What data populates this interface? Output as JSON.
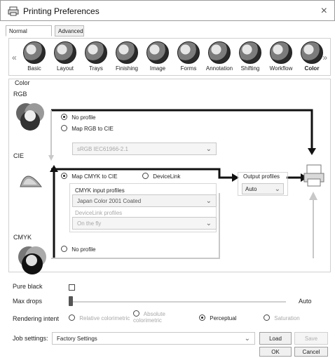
{
  "window": {
    "title": "Printing Preferences"
  },
  "tabs": [
    {
      "label": "Normal"
    },
    {
      "label": "Advanced"
    }
  ],
  "toolbar": {
    "items": [
      {
        "label": "Basic"
      },
      {
        "label": "Layout"
      },
      {
        "label": "Trays"
      },
      {
        "label": "Finishing"
      },
      {
        "label": "Image"
      },
      {
        "label": "Forms"
      },
      {
        "label": "Annotation"
      },
      {
        "label": "Shifting"
      },
      {
        "label": "Workflow"
      },
      {
        "label": "Color"
      }
    ],
    "selected": "Color"
  },
  "color_section": {
    "group_label": "Color",
    "rgb_label": "RGB",
    "cie_label": "CIE",
    "cmyk_label": "CMYK",
    "rgb_options": {
      "no_profile": "No profile",
      "map_rgb_to_cie": "Map RGB to CIE",
      "rgb_profile_value": "sRGB IEC61966-2.1"
    },
    "cmyk_options": {
      "map_cmyk_to_cie": "Map CMYK to CIE",
      "devicelink": "DeviceLink",
      "no_profile": "No profile"
    },
    "cmyk_input_profiles_label": "CMYK input profiles",
    "cmyk_input_profile_value": "Japan Color 2001 Coated",
    "devicelink_profiles_label": "DeviceLink profiles",
    "devicelink_profile_value": "On the fly",
    "output_profiles_label": "Output profiles",
    "output_profile_value": "Auto"
  },
  "pure_black": {
    "label": "Pure black"
  },
  "max_drops": {
    "label": "Max drops",
    "value_label": "Auto"
  },
  "rendering_intent": {
    "label": "Rendering intent",
    "options": [
      "Relative colorimetric",
      "Absolute colorimetric",
      "Perceptual",
      "Saturation"
    ],
    "selected": "Perceptual"
  },
  "job_settings": {
    "label": "Job settings:",
    "value": "Factory Settings",
    "load_label": "Load",
    "save_label": "Save"
  },
  "footer": {
    "ok_label": "OK",
    "cancel_label": "Cancel"
  }
}
